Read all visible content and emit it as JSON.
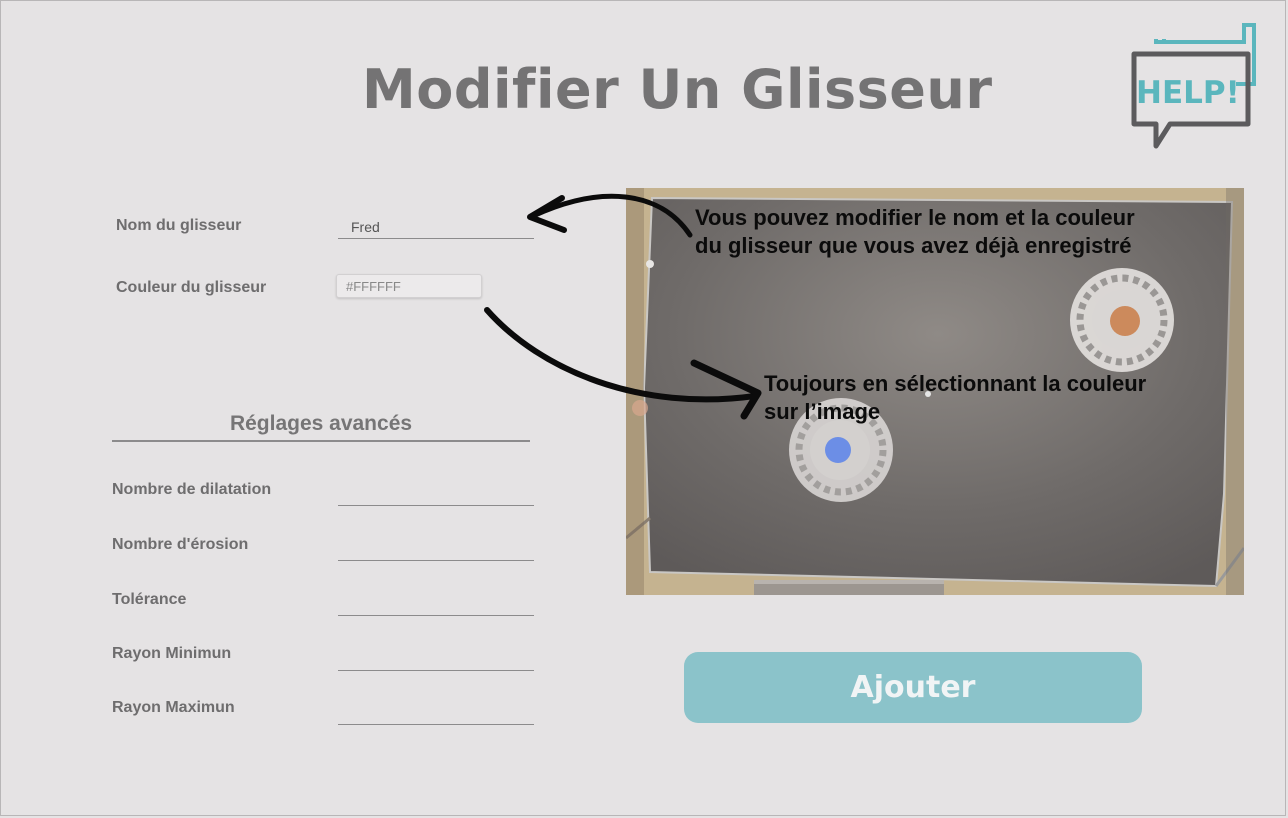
{
  "page": {
    "title": "Modifier Un Glisseur"
  },
  "help": {
    "label": "HELP!"
  },
  "form": {
    "name_label": "Nom du glisseur",
    "name_value": "Fred",
    "color_label": "Couleur du glisseur",
    "color_value": "#FFFFFF"
  },
  "advanced": {
    "title": "Réglages avancés",
    "fields": [
      {
        "label": "Nombre de dilatation"
      },
      {
        "label": "Nombre d'érosion"
      },
      {
        "label": "Tolérance"
      },
      {
        "label": "Rayon Minimun"
      },
      {
        "label": "Rayon Maximun"
      }
    ]
  },
  "annotations": {
    "top_line1": "Vous pouvez modifier le nom et la couleur",
    "top_line2": "du glisseur que vous avez déjà enregistré",
    "mid_line1": "Toujours en sélectionnant la couleur",
    "mid_line2": "sur l’image"
  },
  "actions": {
    "add_label": "Ajouter"
  },
  "colors": {
    "background": "#e5e3e4",
    "accent": "#8bc3ca",
    "help_teal": "#5bb6bd",
    "puck_orange": "#cc8a5c",
    "puck_blue": "#6c8ee6"
  }
}
